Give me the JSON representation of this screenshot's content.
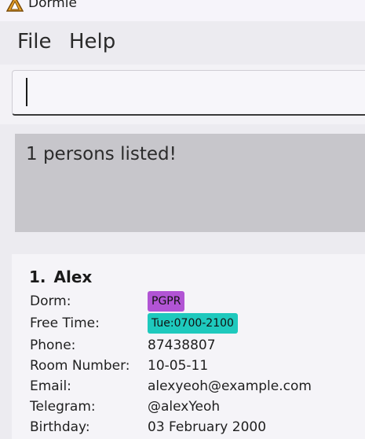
{
  "window": {
    "title": "Dormie"
  },
  "menu": {
    "file": "File",
    "help": "Help"
  },
  "command": {
    "value": ""
  },
  "result": {
    "message": "1 persons listed!"
  },
  "persons": [
    {
      "index": "1.",
      "name": "Alex",
      "labels": {
        "dorm": "Dorm:",
        "free_time": "Free Time:",
        "phone": "Phone:",
        "room": "Room Number:",
        "email": "Email:",
        "telegram": "Telegram:",
        "birthday": "Birthday:"
      },
      "dorm_tag": "PGPR",
      "free_time_tag": "Tue:0700-2100",
      "phone": "87438807",
      "room": "10-05-11",
      "email": "alexyeoh@example.com",
      "telegram": "@alexYeoh",
      "birthday": "03 February 2000"
    }
  ],
  "colors": {
    "dorm_tag": "#b154d4",
    "free_time_tag": "#1ec9bd",
    "result_bg": "#c7c6cb"
  }
}
